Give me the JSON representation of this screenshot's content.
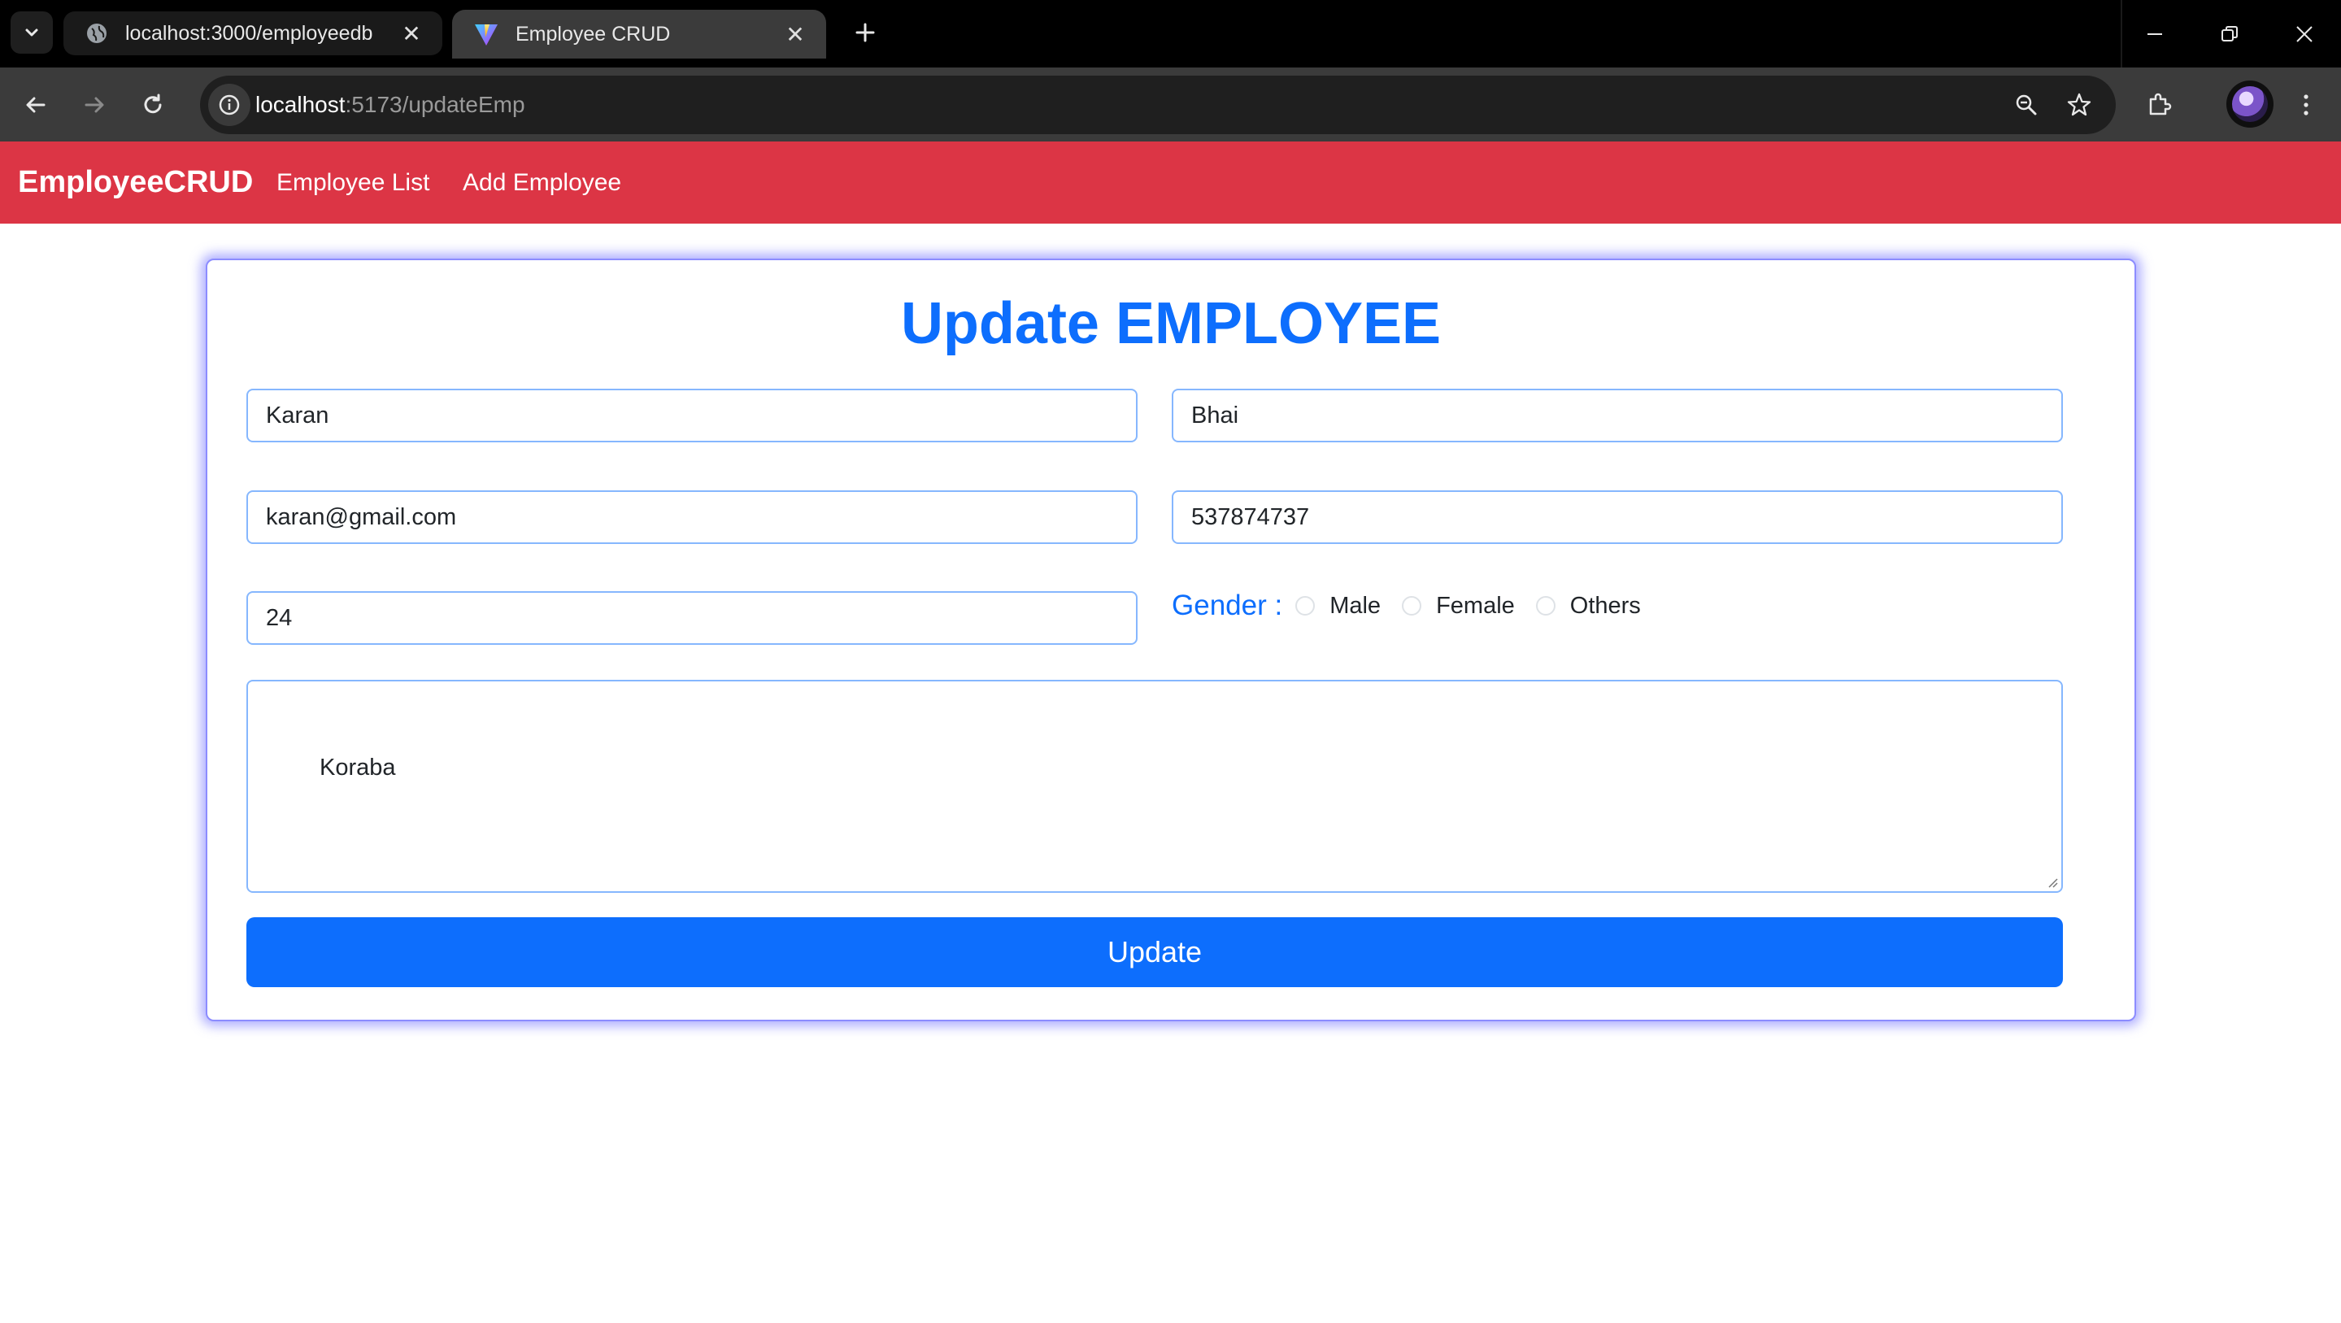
{
  "browser": {
    "tabs": [
      {
        "title": "localhost:3000/employeedb",
        "active": false,
        "favicon": "globe-icon"
      },
      {
        "title": "Employee CRUD",
        "active": true,
        "favicon": "vite-logo-icon"
      }
    ],
    "address": {
      "host": "localhost",
      "path": ":5173/updateEmp"
    }
  },
  "navbar": {
    "brand": "EmployeeCRUD",
    "links": [
      "Employee List",
      "Add Employee"
    ],
    "color": "#dc3545"
  },
  "form": {
    "title": "Update EMPLOYEE",
    "first_name": "Karan",
    "last_name": "Bhai",
    "email": "karan@gmail.com",
    "phone": "537874737",
    "age": "24",
    "gender_label": "Gender :",
    "gender_options": [
      "Male",
      "Female",
      "Others"
    ],
    "address": "Koraba",
    "submit_label": "Update",
    "accent": "#0d6efd"
  }
}
